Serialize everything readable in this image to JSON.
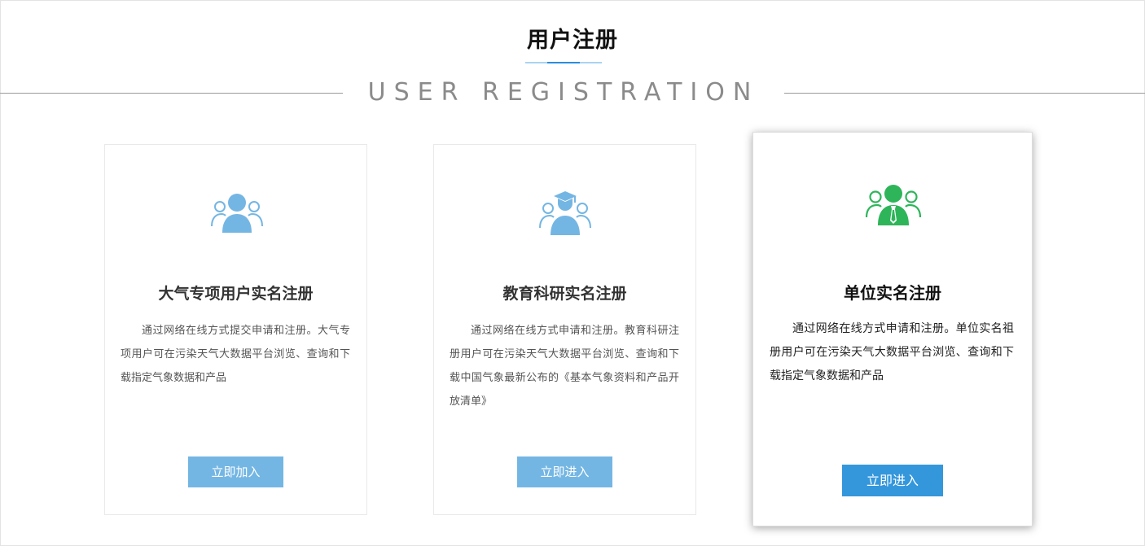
{
  "header": {
    "title": "用户注册",
    "subtitle": "USER REGISTRATION"
  },
  "cards": [
    {
      "icon": "user-group-icon",
      "icon_color": "#74b6e3",
      "title": "大气专项用户实名注册",
      "description": "通过网络在线方式提交申请和注册。大气专项用户可在污染天气大数据平台浏览、查询和下载指定气象数据和产品",
      "button": "立即加入"
    },
    {
      "icon": "graduate-group-icon",
      "icon_color": "#74b6e3",
      "title": "教育科研实名注册",
      "description": "通过网络在线方式申请和注册。教育科研注册用户可在污染天气大数据平台浏览、查询和下载中国气象最新公布的《基本气象资料和产品开放清单》",
      "button": "立即进入"
    },
    {
      "icon": "business-group-icon",
      "icon_color": "#2eb55a",
      "title": "单位实名注册",
      "description": "通过网络在线方式申请和注册。单位实名祖册用户可在污染天气大数据平台浏览、查询和下载指定气象数据和产品",
      "button": "立即进入"
    }
  ]
}
